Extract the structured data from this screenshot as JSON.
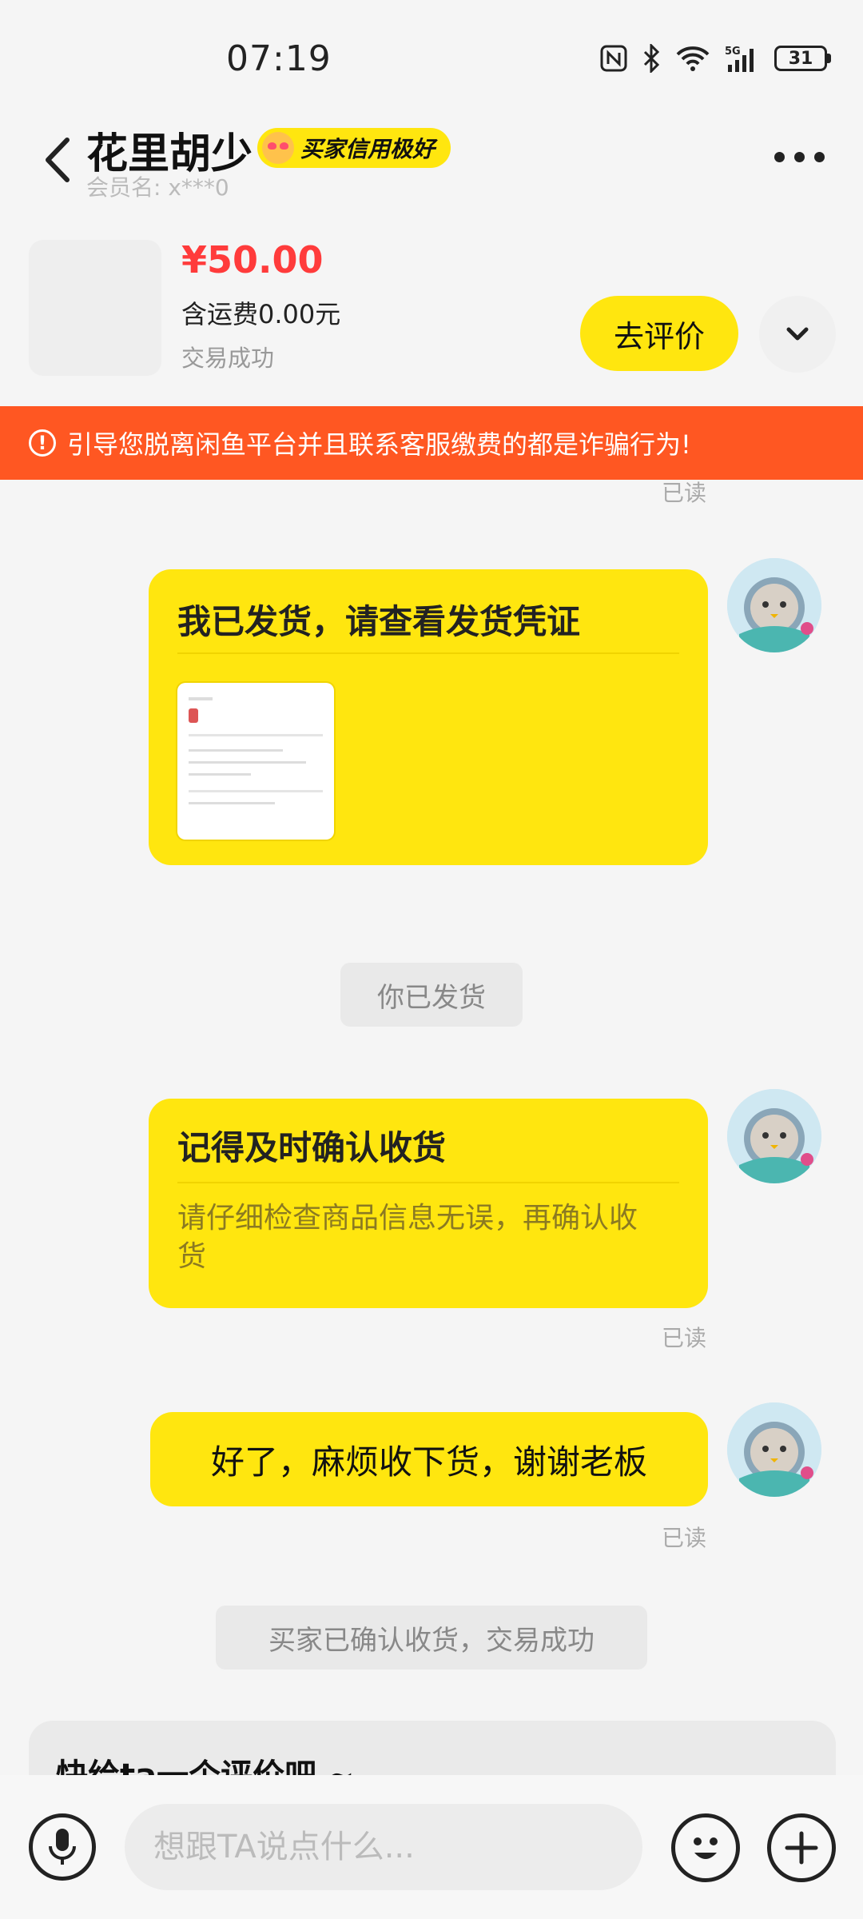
{
  "status_bar": {
    "time": "07:19",
    "battery": "31"
  },
  "header": {
    "contact_name": "花里胡少",
    "credit_badge": "买家信用极好",
    "member_label": "会员名: x***0"
  },
  "product": {
    "price": "¥50.00",
    "shipping": "含运费0.00元",
    "status": "交易成功",
    "review_button": "去评价"
  },
  "warning": "引导您脱离闲鱼平台并且联系客服缴费的都是诈骗行为!",
  "messages": {
    "read_label": "已读",
    "shipped_card_title": "我已发货，请查看发货凭证",
    "system_shipped": "你已发货",
    "confirm_card_title": "记得及时确认收货",
    "confirm_card_sub": "请仔细检查商品信息无误，再确认收货",
    "text_message": "好了，麻烦收下货，谢谢老板",
    "system_confirmed": "买家已确认收货，交易成功"
  },
  "review_prompt": "快给ta一个评价吧 ~",
  "input": {
    "placeholder": "想跟TA说点什么..."
  },
  "icons": [
    "back-icon",
    "more-icon",
    "chevron-down-icon",
    "warning-icon",
    "mic-icon",
    "emoji-icon",
    "plus-icon",
    "nfc-icon",
    "bluetooth-icon",
    "wifi-icon",
    "signal-icon",
    "battery-icon"
  ],
  "colors": {
    "accent": "#ffe60f",
    "warning": "#ff5722",
    "price": "#ff3b3b"
  }
}
